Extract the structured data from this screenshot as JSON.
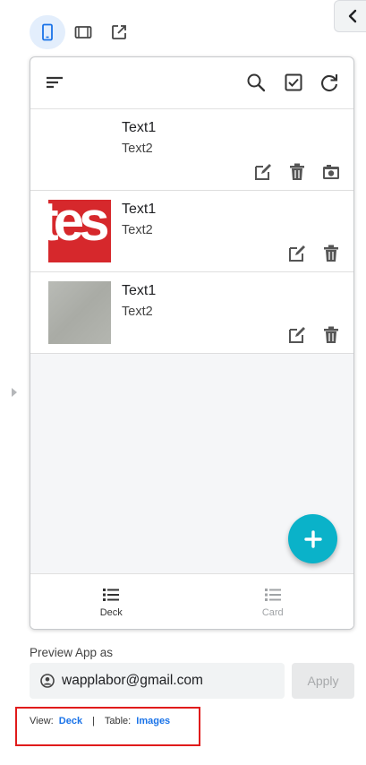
{
  "panel": {
    "collapse_icon": "chevron-left-icon"
  },
  "device_toggle": {
    "items": [
      "mobile-icon",
      "tablet-icon",
      "external-link-icon"
    ],
    "active": "mobile-icon"
  },
  "app": {
    "appbar": {
      "menu_icon": "sort-icon",
      "actions": [
        "search-icon",
        "checkbox-icon",
        "refresh-icon"
      ]
    },
    "rows": [
      {
        "title": "Text1",
        "subtitle": "Text2",
        "thumb": "none",
        "thumb_text": "",
        "actions": [
          "edit-icon",
          "delete-icon",
          "camera-icon"
        ]
      },
      {
        "title": "Text1",
        "subtitle": "Text2",
        "thumb": "red",
        "thumb_text": "tes",
        "actions": [
          "edit-icon",
          "delete-icon"
        ]
      },
      {
        "title": "Text1",
        "subtitle": "Text2",
        "thumb": "grey",
        "thumb_text": "",
        "actions": [
          "edit-icon",
          "delete-icon"
        ]
      }
    ],
    "fab_icon": "plus-icon",
    "bottom_nav": [
      {
        "label": "Deck",
        "icon": "list-icon",
        "active": true
      },
      {
        "label": "Card",
        "icon": "list-icon",
        "active": false
      }
    ]
  },
  "preview": {
    "label": "Preview App as",
    "account_icon": "account-circle-icon",
    "email": "wapplabor@gmail.com",
    "apply_label": "Apply"
  },
  "footer": {
    "view_label": "View:",
    "view_value": "Deck",
    "separator": "|",
    "table_label": "Table:",
    "table_value": "Images"
  },
  "colors": {
    "accent": "#1a73e8",
    "fab": "#0ab2c9",
    "highlight_border": "#e01b1b"
  }
}
